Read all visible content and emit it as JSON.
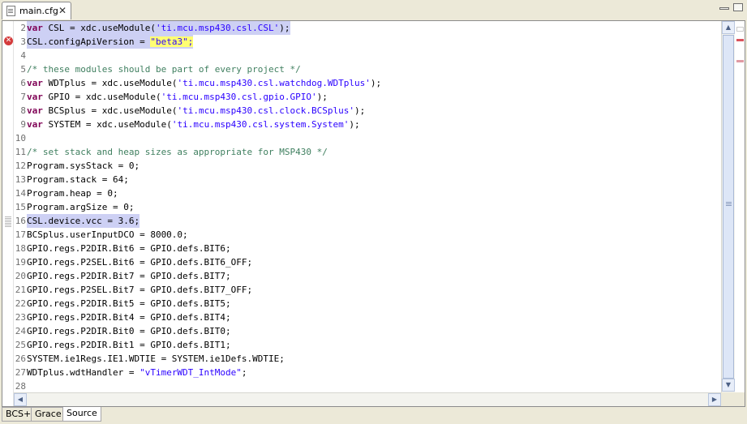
{
  "tab": {
    "title": "main.cfg",
    "close": "✕"
  },
  "editor": {
    "error_icon": "x-circle-icon",
    "lines": [
      {
        "n": "2",
        "segs": [
          {
            "t": "var",
            "c": "kw"
          },
          {
            "t": " CSL = xdc.useModule("
          },
          {
            "t": "'ti.mcu.msp430.csl.CSL'",
            "c": "str"
          },
          {
            "t": ");"
          }
        ],
        "hl": true
      },
      {
        "n": "3",
        "segs": [
          {
            "t": "CSL.configApiVersion = "
          },
          {
            "t": "\"beta3\";",
            "c": "str yl"
          }
        ],
        "hl": true
      },
      {
        "n": "4",
        "segs": []
      },
      {
        "n": "5",
        "segs": [
          {
            "t": "/* these modules should be part of every project */",
            "c": "cmt"
          }
        ]
      },
      {
        "n": "6",
        "segs": [
          {
            "t": "var",
            "c": "kw"
          },
          {
            "t": " WDTplus = xdc.useModule("
          },
          {
            "t": "'ti.mcu.msp430.csl.watchdog.WDTplus'",
            "c": "str"
          },
          {
            "t": ");"
          }
        ]
      },
      {
        "n": "7",
        "segs": [
          {
            "t": "var",
            "c": "kw"
          },
          {
            "t": " GPIO = xdc.useModule("
          },
          {
            "t": "'ti.mcu.msp430.csl.gpio.GPIO'",
            "c": "str"
          },
          {
            "t": ");"
          }
        ]
      },
      {
        "n": "8",
        "segs": [
          {
            "t": "var",
            "c": "kw"
          },
          {
            "t": " BCSplus = xdc.useModule("
          },
          {
            "t": "'ti.mcu.msp430.csl.clock.BCSplus'",
            "c": "str"
          },
          {
            "t": ");"
          }
        ]
      },
      {
        "n": "9",
        "segs": [
          {
            "t": "var",
            "c": "kw"
          },
          {
            "t": " SYSTEM = xdc.useModule("
          },
          {
            "t": "'ti.mcu.msp430.csl.system.System'",
            "c": "str"
          },
          {
            "t": ");"
          }
        ]
      },
      {
        "n": "10",
        "segs": []
      },
      {
        "n": "11",
        "segs": [
          {
            "t": "/* set stack and heap sizes as appropriate for MSP430 */",
            "c": "cmt"
          }
        ]
      },
      {
        "n": "12",
        "segs": [
          {
            "t": "Program.sysStack = 0;"
          }
        ]
      },
      {
        "n": "13",
        "segs": [
          {
            "t": "Program.stack = 64;"
          }
        ]
      },
      {
        "n": "14",
        "segs": [
          {
            "t": "Program.heap = 0;"
          }
        ]
      },
      {
        "n": "15",
        "segs": [
          {
            "t": "Program.argSize = 0;"
          }
        ]
      },
      {
        "n": "16",
        "segs": [
          {
            "t": "CSL.device.vcc = 3.6;"
          }
        ],
        "hl": true
      },
      {
        "n": "17",
        "segs": [
          {
            "t": "BCSplus.userInputDCO = 8000.0;"
          }
        ]
      },
      {
        "n": "18",
        "segs": [
          {
            "t": "GPIO.regs.P2DIR.Bit6 = GPIO.defs.BIT6;"
          }
        ]
      },
      {
        "n": "19",
        "segs": [
          {
            "t": "GPIO.regs.P2SEL.Bit6 = GPIO.defs.BIT6_OFF;"
          }
        ]
      },
      {
        "n": "20",
        "segs": [
          {
            "t": "GPIO.regs.P2DIR.Bit7 = GPIO.defs.BIT7;"
          }
        ]
      },
      {
        "n": "21",
        "segs": [
          {
            "t": "GPIO.regs.P2SEL.Bit7 = GPIO.defs.BIT7_OFF;"
          }
        ]
      },
      {
        "n": "22",
        "segs": [
          {
            "t": "GPIO.regs.P2DIR.Bit5 = GPIO.defs.BIT5;"
          }
        ]
      },
      {
        "n": "23",
        "segs": [
          {
            "t": "GPIO.regs.P2DIR.Bit4 = GPIO.defs.BIT4;"
          }
        ]
      },
      {
        "n": "24",
        "segs": [
          {
            "t": "GPIO.regs.P2DIR.Bit0 = GPIO.defs.BIT0;"
          }
        ]
      },
      {
        "n": "25",
        "segs": [
          {
            "t": "GPIO.regs.P2DIR.Bit1 = GPIO.defs.BIT1;"
          }
        ]
      },
      {
        "n": "26",
        "segs": [
          {
            "t": "SYSTEM.ie1Regs.IE1.WDTIE = SYSTEM.ie1Defs.WDTIE;"
          }
        ]
      },
      {
        "n": "27",
        "segs": [
          {
            "t": "WDTplus.wdtHandler = "
          },
          {
            "t": "\"vTimerWDT_IntMode\"",
            "c": "str"
          },
          {
            "t": ";"
          }
        ]
      },
      {
        "n": "28",
        "segs": []
      }
    ]
  },
  "scrollbars": {
    "up": "▲",
    "down": "▼",
    "left": "◀",
    "right": "▶"
  },
  "bottom_tabs": [
    {
      "label": "BCS+",
      "active": false
    },
    {
      "label": "Grace",
      "active": false
    },
    {
      "label": "Source",
      "active": true
    }
  ]
}
